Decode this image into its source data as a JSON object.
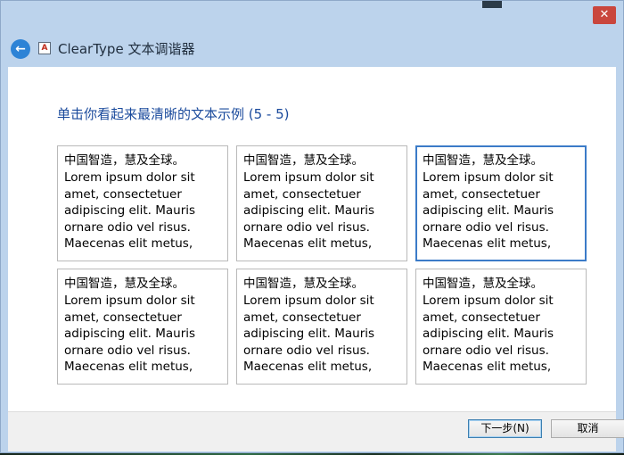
{
  "window": {
    "close_glyph": "✕",
    "title": "ClearType 文本调谐器",
    "back_glyph": "←",
    "app_icon_glyph": "A"
  },
  "main": {
    "instruction": "单击你看起来最清晰的文本示例 (5 - 5)",
    "samples": [
      {
        "cjk": "中国智造，慧及全球。",
        "text": "Lorem ipsum dolor sit amet, consectetuer adipiscing elit. Mauris ornare odio vel risus. Maecenas elit metus,"
      },
      {
        "cjk": "中国智造，慧及全球。",
        "text": "Lorem ipsum dolor sit amet, consectetuer adipiscing elit. Mauris ornare odio vel risus. Maecenas elit metus,"
      },
      {
        "cjk": "中国智造，慧及全球。",
        "text": "Lorem ipsum dolor sit amet, consectetuer adipiscing elit. Mauris ornare odio vel risus. Maecenas elit metus,"
      },
      {
        "cjk": "中国智造，慧及全球。",
        "text": "Lorem ipsum dolor sit amet, consectetuer adipiscing elit. Mauris ornare odio vel risus. Maecenas elit metus,"
      },
      {
        "cjk": "中国智造，慧及全球。",
        "text": "Lorem ipsum dolor sit amet, consectetuer adipiscing elit. Mauris ornare odio vel risus. Maecenas elit metus,"
      },
      {
        "cjk": "中国智造，慧及全球。",
        "text": "Lorem ipsum dolor sit amet, consectetuer adipiscing elit. Mauris ornare odio vel risus. Maecenas elit metus,"
      }
    ],
    "selected_index": 2
  },
  "footer": {
    "next_label": "下一步(N)",
    "cancel_label": "取消"
  },
  "colors": {
    "frame": "#bcd3ec",
    "accent": "#1a4a9c",
    "selection": "#3b7bc8"
  }
}
